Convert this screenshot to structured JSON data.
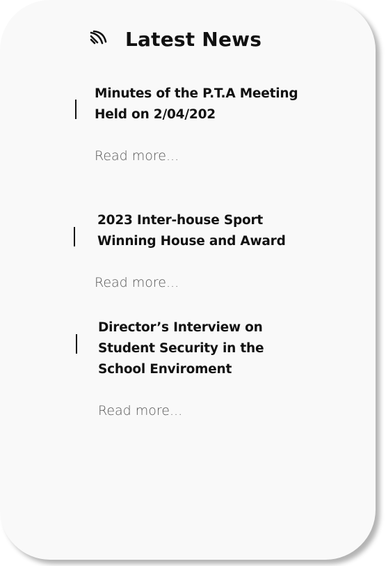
{
  "header": {
    "title": "Latest News",
    "icon": "news-feed-icon"
  },
  "news": [
    {
      "title_lines": [
        "Minutes of the P.T.A Meeting",
        "Held on 2/04/202"
      ],
      "read_more": "Read more..."
    },
    {
      "title_lines": [
        "2023 Inter-house Sport",
        "Winning House and Award"
      ],
      "read_more": "Read more..."
    },
    {
      "title_lines": [
        "Director’s Interview on",
        "Student Security in the",
        "School Enviroment"
      ],
      "read_more": "Read more..."
    }
  ],
  "colors": {
    "card_background": "#f9f9f9",
    "text_primary": "#111111",
    "text_secondary": "#555555"
  }
}
